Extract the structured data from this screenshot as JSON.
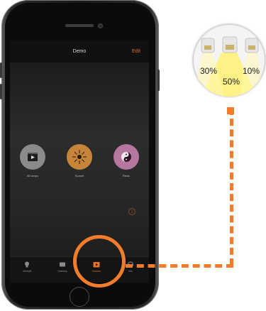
{
  "app": {
    "title": "Demo",
    "action_label": "Edit",
    "info_glyph": "i"
  },
  "scenes": [
    {
      "label": "All lamps",
      "icon": "film-icon",
      "color": "#8a8a8a"
    },
    {
      "label": "Sunset",
      "icon": "sunburst-icon",
      "color": "#c7853a"
    },
    {
      "label": "Relax",
      "icon": "yin-yang-icon",
      "color": "#b6779e"
    }
  ],
  "tabs": [
    {
      "label": "Lifestyle",
      "icon": "bulb-icon",
      "active": false
    },
    {
      "label": "Gateway",
      "icon": "gateway-icon",
      "active": false
    },
    {
      "label": "Scenes",
      "icon": "scenes-icon",
      "active": true
    },
    {
      "label": "Info",
      "icon": "info-icon",
      "active": false
    }
  ],
  "magnifier": {
    "lamp_a_pct": "30%",
    "lamp_b_pct": "50%",
    "lamp_c_pct": "10%"
  },
  "colors": {
    "accent": "#f07c2c",
    "beam": "#fff27a"
  }
}
